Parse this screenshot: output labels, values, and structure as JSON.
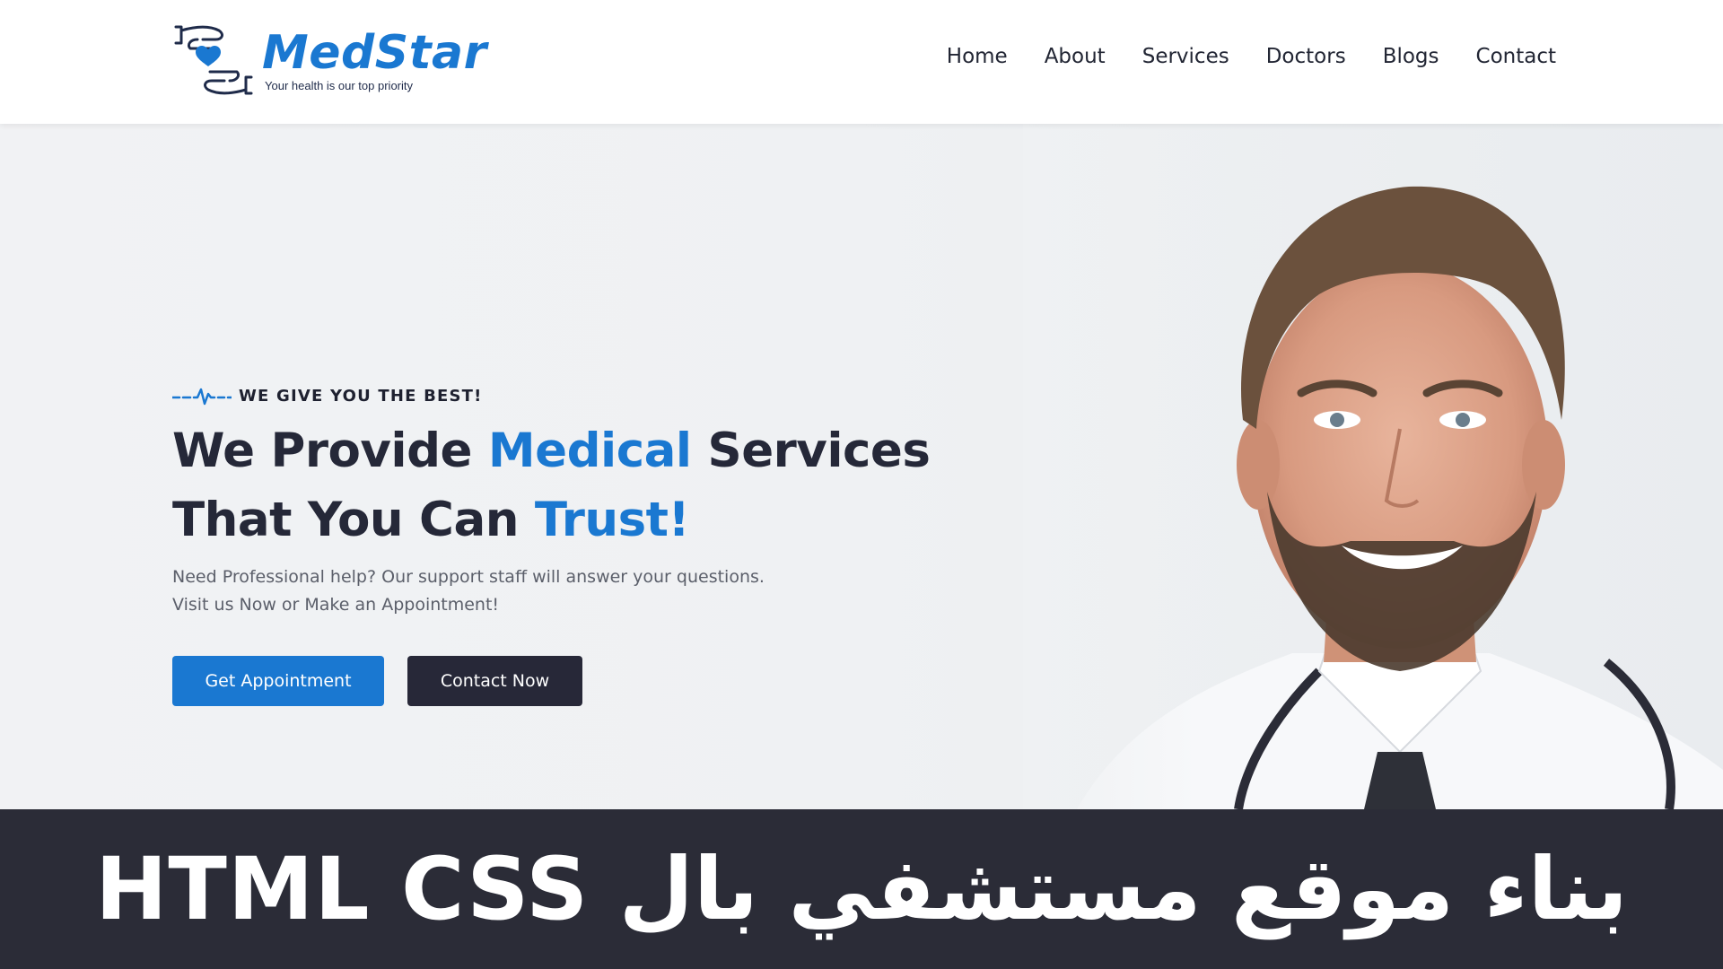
{
  "brand": {
    "name": "MedStar",
    "tagline": "Your health is our top priority",
    "logo_icon": "hand-heart-icon",
    "color": "#1a78d1"
  },
  "nav": {
    "items": [
      {
        "label": "Home"
      },
      {
        "label": "About"
      },
      {
        "label": "Services"
      },
      {
        "label": "Doctors"
      },
      {
        "label": "Blogs"
      },
      {
        "label": "Contact"
      }
    ]
  },
  "hero": {
    "kicker_icon": "heartbeat-line-icon",
    "kicker": "WE GIVE YOU THE BEST!",
    "title": {
      "line1_part1": "We Provide ",
      "line1_accent": "Medical",
      "line1_part2": " Services",
      "line2_part1": "That You Can ",
      "line2_accent": "Trust!"
    },
    "description_line1": "Need Professional help? Our support staff will answer your questions.",
    "description_line2": "Visit us Now or Make an Appointment!",
    "primary_button": "Get Appointment",
    "secondary_button": "Contact Now",
    "accent_color": "#1a78d1",
    "dark_color": "#272838"
  },
  "caption": {
    "text": "بناء موقع مستشفي بال HTML CSS",
    "background": "#2b2c37"
  }
}
